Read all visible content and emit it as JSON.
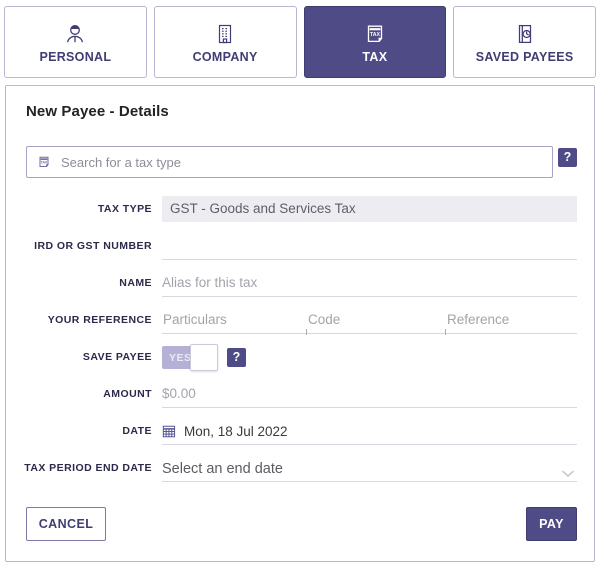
{
  "theme": {
    "accent": "#4e4b86",
    "accent_border": "#3f3c72",
    "card_border": "#b9b7d2",
    "label_color": "#2b2a4a",
    "placeholder": "#a3a3ab",
    "readonly_bg": "#ededf1",
    "toggle_on_bg": "#b5b1d6"
  },
  "tabs": [
    {
      "id": "personal",
      "label": "PERSONAL",
      "icon": "person-icon",
      "active": false
    },
    {
      "id": "company",
      "label": "COMPANY",
      "icon": "building-icon",
      "active": false
    },
    {
      "id": "tax",
      "label": "TAX",
      "icon": "tax-document-icon",
      "active": true
    },
    {
      "id": "saved_payees",
      "label": "SAVED PAYEES",
      "icon": "address-book-icon",
      "active": false
    }
  ],
  "card": {
    "title": "New Payee - Details",
    "search": {
      "placeholder": "Search for a tax type",
      "icon": "tax-document-icon",
      "value": ""
    },
    "help_label": "?",
    "fields": {
      "tax_type": {
        "label": "TAX TYPE",
        "value": "GST - Goods and Services Tax",
        "readonly": true
      },
      "ird_or_gst_number": {
        "label": "IRD OR GST NUMBER",
        "value": "",
        "placeholder": ""
      },
      "name": {
        "label": "NAME",
        "value": "",
        "placeholder": "Alias for this tax"
      },
      "your_reference": {
        "label": "YOUR REFERENCE",
        "particulars_placeholder": "Particulars",
        "code_placeholder": "Code",
        "reference_placeholder": "Reference"
      },
      "save_payee": {
        "label": "SAVE PAYEE",
        "toggle_text": "YES",
        "state": "on",
        "help_label": "?"
      },
      "amount": {
        "label": "AMOUNT",
        "value": "",
        "placeholder": "$0.00"
      },
      "date": {
        "label": "DATE",
        "value": "Mon, 18 Jul 2022",
        "icon": "calendar-icon"
      },
      "tax_period_end_date": {
        "label": "TAX PERIOD END DATE",
        "value": "Select an end date",
        "icon": "chevron-down-icon"
      }
    },
    "buttons": {
      "cancel": "CANCEL",
      "pay": "PAY"
    }
  }
}
